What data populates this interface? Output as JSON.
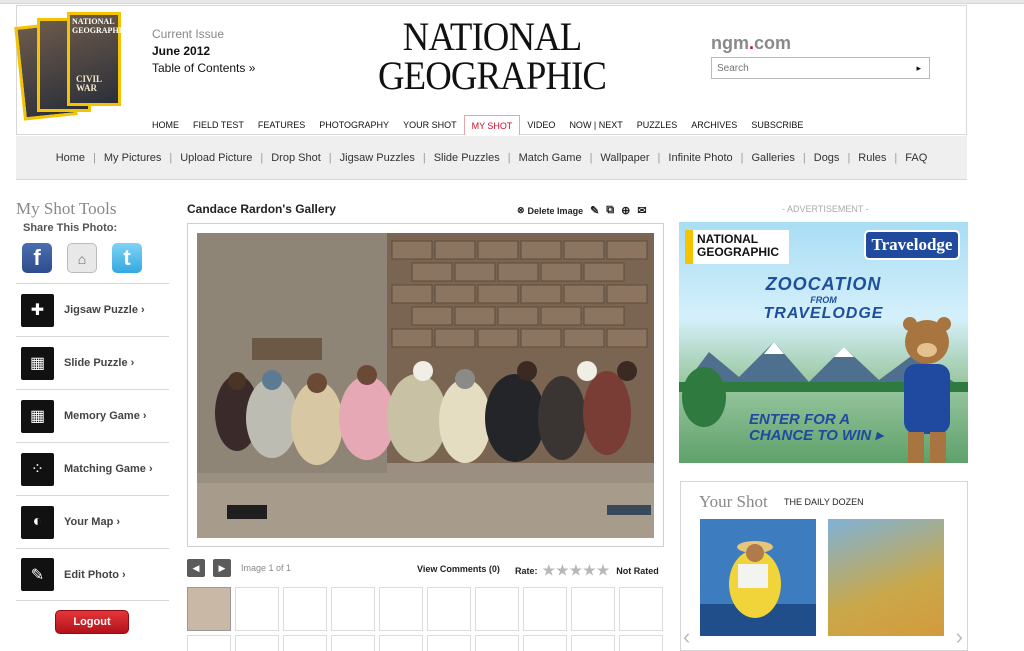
{
  "header": {
    "current_issue_label": "Current Issue",
    "issue_date": "June 2012",
    "toc_link": "Table of Contents »",
    "logo_line1": "NATIONAL",
    "logo_line2": "GEOGRAPHIC",
    "ngm_prefix": "ngm",
    "ngm_dot": ".",
    "ngm_suffix": "com",
    "search_placeholder": "Search",
    "search_go": "▸",
    "cover_title": "NATIONAL GEOGRAPHIC",
    "cover_story": "CIVIL WAR"
  },
  "main_nav": [
    "HOME",
    "FIELD TEST",
    "FEATURES",
    "PHOTOGRAPHY",
    "YOUR SHOT",
    "MY SHOT",
    "VIDEO",
    "NOW | NEXT",
    "PUZZLES",
    "ARCHIVES",
    "SUBSCRIBE"
  ],
  "main_nav_active": "MY SHOT",
  "sub_nav": [
    "Home",
    "My Pictures",
    "Upload Picture",
    "Drop Shot",
    "Jigsaw Puzzles",
    "Slide Puzzles",
    "Match Game",
    "Wallpaper",
    "Infinite Photo",
    "Galleries",
    "Dogs",
    "Rules",
    "FAQ"
  ],
  "tools": {
    "title": "My Shot Tools",
    "share_label": "Share This Photo:",
    "social": [
      {
        "name": "facebook-icon",
        "glyph": "f"
      },
      {
        "name": "share-icon",
        "glyph": "⌂"
      },
      {
        "name": "twitter-icon",
        "glyph": "t"
      }
    ],
    "items": [
      {
        "label": "Jigsaw Puzzle ›",
        "icon": "jigsaw-icon",
        "glyph": "✚"
      },
      {
        "label": "Slide Puzzle ›",
        "icon": "slide-puzzle-icon",
        "glyph": "▦"
      },
      {
        "label": "Memory Game ›",
        "icon": "memory-game-icon",
        "glyph": "▦"
      },
      {
        "label": "Matching Game ›",
        "icon": "matching-game-icon",
        "glyph": "⁘"
      },
      {
        "label": "Your Map ›",
        "icon": "globe-icon",
        "glyph": "◐"
      },
      {
        "label": "Edit Photo ›",
        "icon": "edit-photo-icon",
        "glyph": "✎"
      }
    ],
    "logout": "Logout"
  },
  "gallery": {
    "title": "Candace Rardon's Gallery",
    "delete_label": "Delete Image",
    "pager_info": "Image 1 of 1",
    "view_comments": "View Comments (0)",
    "rate_label": "Rate:",
    "stars": "★★★★★",
    "rating_status": "Not Rated"
  },
  "ad": {
    "label": "- ADVERTISEMENT -",
    "ng_line1": "NATIONAL",
    "ng_line2": "GEOGRAPHIC",
    "brand": "Travelodge",
    "zoo_a": "ZOOCATION",
    "zoo_b": "FROM",
    "zoo_c": "TRAVELODGE",
    "enter_1": "ENTER FOR A",
    "enter_2": "CHANCE TO WIN ▸"
  },
  "your_shot": {
    "title": "Your Shot",
    "subtitle": "THE DAILY DOZEN"
  },
  "colors": {
    "accent_red": "#c8102e",
    "ng_yellow": "#f4c400",
    "travelodge_blue": "#1f4a9e"
  }
}
